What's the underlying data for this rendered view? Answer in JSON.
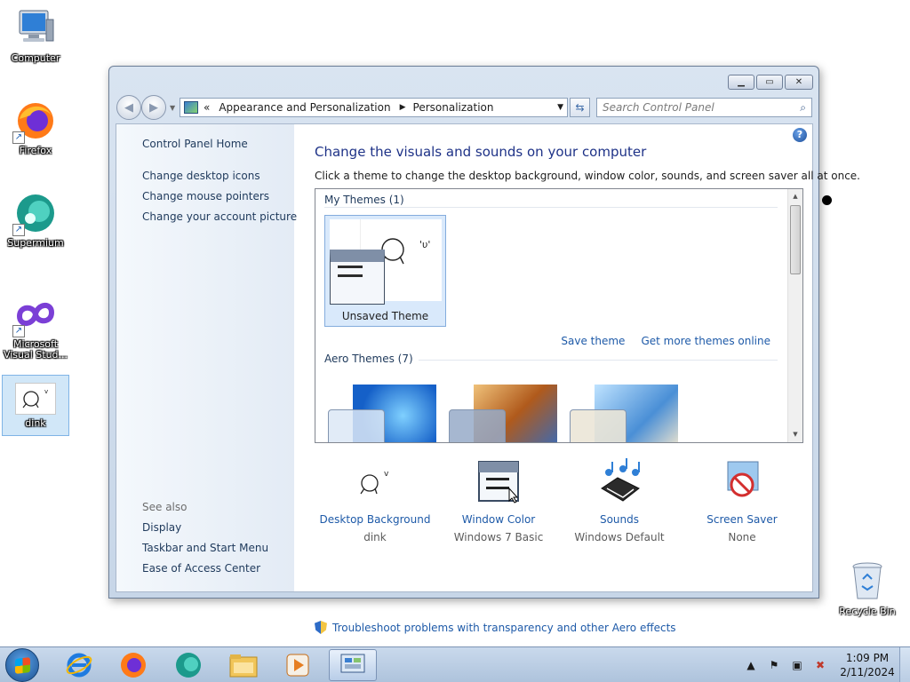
{
  "desktop": {
    "icons": [
      {
        "label": "Computer"
      },
      {
        "label": "Firefox"
      },
      {
        "label": "Supermium"
      },
      {
        "label": "Microsoft Visual Stud..."
      },
      {
        "label": "dink"
      }
    ],
    "recycle_bin": "Recycle Bin"
  },
  "window": {
    "address": {
      "overflow": "«",
      "crumbs": [
        "Appearance and Personalization",
        "Personalization"
      ]
    },
    "search_placeholder": "Search Control Panel",
    "left_pane": {
      "home": "Control Panel Home",
      "links": [
        "Change desktop icons",
        "Change mouse pointers",
        "Change your account picture"
      ],
      "see_also_title": "See also",
      "see_also": [
        "Display",
        "Taskbar and Start Menu",
        "Ease of Access Center"
      ]
    },
    "main": {
      "title": "Change the visuals and sounds on your computer",
      "description": "Click a theme to change the desktop background, window color, sounds, and screen saver all at once.",
      "my_themes_title": "My Themes (1)",
      "selected_theme": "Unsaved Theme",
      "save_theme": "Save theme",
      "get_more": "Get more themes online",
      "aero_themes_title": "Aero Themes (7)"
    },
    "bottom": [
      {
        "title": "Desktop Background",
        "value": "dink"
      },
      {
        "title": "Window Color",
        "value": "Windows 7 Basic"
      },
      {
        "title": "Sounds",
        "value": "Windows Default"
      },
      {
        "title": "Screen Saver",
        "value": "None"
      }
    ],
    "troubleshoot": "Troubleshoot problems with transparency and other Aero effects"
  },
  "taskbar": {
    "clock_time": "1:09 PM",
    "clock_date": "2/11/2024"
  },
  "colors": {
    "link": "#1e5aa8",
    "title": "#1e3287",
    "selection": "#d9e9fb"
  }
}
